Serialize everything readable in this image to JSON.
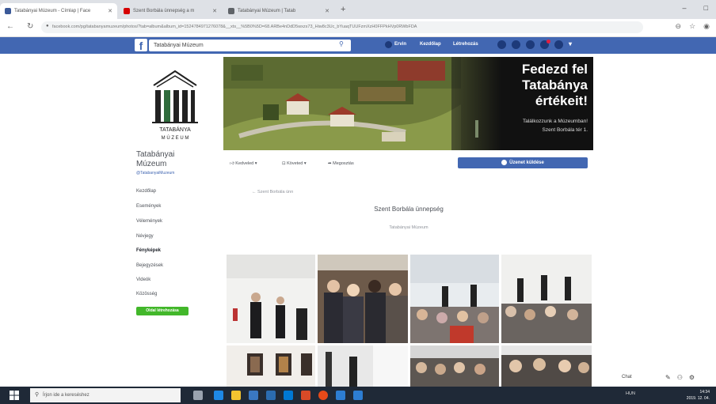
{
  "browser": {
    "tabs": [
      {
        "label": "Tatabányai Múzeum - Címlap | Face",
        "color": "#3b5998"
      },
      {
        "label": "Szent Borbála ünnepség a m",
        "color": "#d60000"
      },
      {
        "label": "Tatabányai Múzeum | Tatab",
        "color": "#5f6368"
      }
    ],
    "new_tab": "+",
    "url": "facebook.com/pg/tatabanyamuzeum/photos/?tab=album&album_id=1524784971276078&__xts__%5B0%5D=68.ARBe4nDdD5wxzs73_Hiw8c3Uc_bYuaqTUUFzmXzH0FFPkHVp0RWbFDA",
    "window_controls": [
      "–",
      "□"
    ]
  },
  "facebook": {
    "search_value": "Tatabányai Múzeum",
    "nav": [
      "Ervin",
      "Kezdőlap",
      "Létrehozás"
    ]
  },
  "page": {
    "name_line1": "Tatabányai",
    "name_line2": "Múzeum",
    "handle": "@TatabanyaiMuzeum",
    "logo_text_top": "TATABÁNYA",
    "logo_text_bottom": "M Ú Z E U M",
    "sidebar": [
      "Kezdőlap",
      "Események",
      "Vélemények",
      "Névjegy",
      "Fényképek",
      "Bejegyzések",
      "Videók",
      "Közösség"
    ],
    "active_sidebar": "Fényképek",
    "sidebar_button": "Oldal létrehozása"
  },
  "cover": {
    "title_lines": [
      "Fedezd fel",
      "Tatabánya",
      "értékeit!"
    ],
    "sub_lines": [
      "Találkozzunk a Múzeumban!",
      "Szent Borbála tér 1."
    ]
  },
  "actions": {
    "like": "Kedveled",
    "follow": "Követed",
    "share": "Megosztás",
    "send_message": "Üzenet küldése"
  },
  "album": {
    "breadcrumb": "← Szent Borbála ünn",
    "title": "Szent Borbála ünnepség",
    "subtitle": "Tatabányai Múzeum"
  },
  "taskbar": {
    "search_placeholder": "Írjon ide a kereséshez",
    "tray_time": "14:34",
    "tray_date": "2019. 12. 04.",
    "tray_lang": "HUN"
  },
  "overlay": {
    "label": "Chat"
  }
}
